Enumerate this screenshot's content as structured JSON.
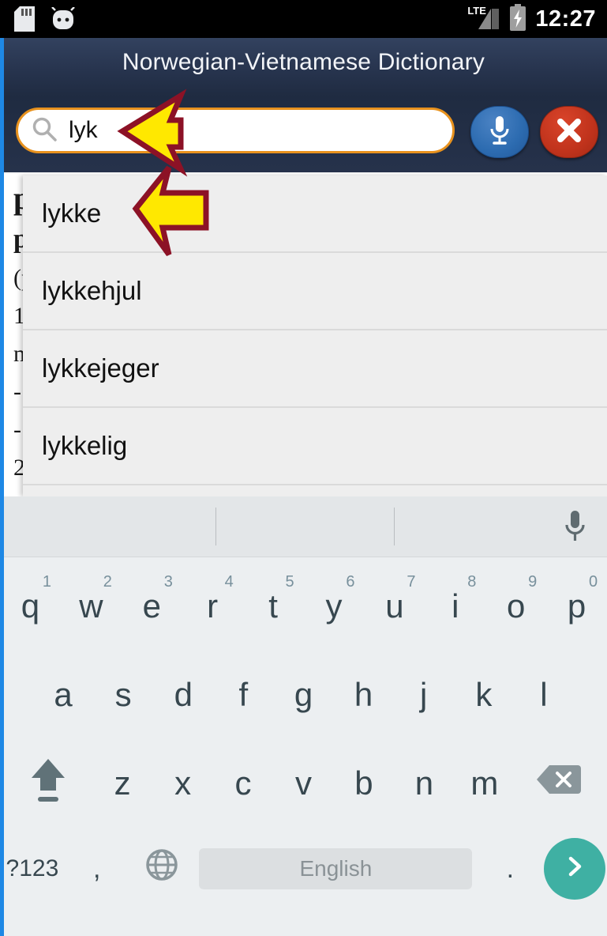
{
  "statusbar": {
    "time": "12:27",
    "network_label": "LTE",
    "icons": [
      "sd-card-icon",
      "android-head-icon",
      "lte-signal-icon",
      "battery-charging-icon"
    ]
  },
  "titlebar": {
    "title": "Norwegian-Vietnamese Dictionary"
  },
  "search": {
    "value": "lyk",
    "placeholder": "",
    "search_icon": "search-icon",
    "mic_button_label": "microphone-icon",
    "clear_button_label": "close-icon"
  },
  "suggestions": {
    "items": [
      {
        "label": "lykke"
      },
      {
        "label": "lykkehjul"
      },
      {
        "label": "lykkejeger"
      },
      {
        "label": "lykkelig"
      }
    ]
  },
  "background_entry": {
    "lines": [
      "p",
      "p",
      "(p",
      "1",
      "n",
      "-",
      "-",
      "2"
    ]
  },
  "keyboard": {
    "suggestion_bar": {
      "mic_icon": "microphone-icon"
    },
    "row1": [
      {
        "letter": "q",
        "num": "1"
      },
      {
        "letter": "w",
        "num": "2"
      },
      {
        "letter": "e",
        "num": "3"
      },
      {
        "letter": "r",
        "num": "4"
      },
      {
        "letter": "t",
        "num": "5"
      },
      {
        "letter": "y",
        "num": "6"
      },
      {
        "letter": "u",
        "num": "7"
      },
      {
        "letter": "i",
        "num": "8"
      },
      {
        "letter": "o",
        "num": "9"
      },
      {
        "letter": "p",
        "num": "0"
      }
    ],
    "row2": [
      {
        "letter": "a"
      },
      {
        "letter": "s"
      },
      {
        "letter": "d"
      },
      {
        "letter": "f"
      },
      {
        "letter": "g"
      },
      {
        "letter": "h"
      },
      {
        "letter": "j"
      },
      {
        "letter": "k"
      },
      {
        "letter": "l"
      }
    ],
    "row3": [
      {
        "letter": "z"
      },
      {
        "letter": "x"
      },
      {
        "letter": "c"
      },
      {
        "letter": "v"
      },
      {
        "letter": "b"
      },
      {
        "letter": "n"
      },
      {
        "letter": "m"
      }
    ],
    "shift_key": "shift-icon",
    "backspace_key": "backspace-icon",
    "row4": {
      "symbols_label": "?123",
      "comma_label": ",",
      "globe_label": "globe-icon",
      "space_label": "English",
      "period_label": ".",
      "enter_label": "chevron-right-icon"
    }
  },
  "annotations": {
    "arrows": [
      {
        "name": "arrow-to-search-field"
      },
      {
        "name": "arrow-to-suggestion-lykke"
      }
    ]
  },
  "colors": {
    "header_navy": "#27344e",
    "search_border_orange": "#e8921e",
    "mic_blue": "#2c6bb0",
    "clear_red": "#c0331c",
    "left_edge_blue": "#1e88e5",
    "enter_teal": "#3fb0a3",
    "arrow_fill": "#ffe800",
    "arrow_stroke": "#8c1226",
    "suggestion_bg": "#eeeeee"
  }
}
